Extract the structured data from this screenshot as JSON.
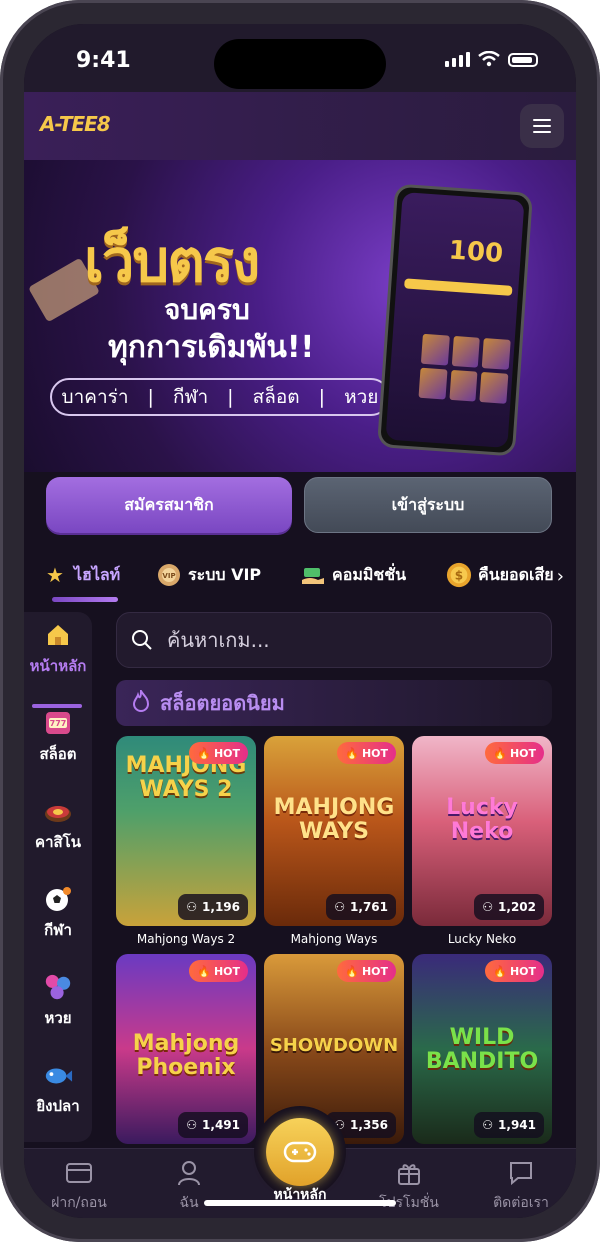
{
  "status_bar": {
    "time": "9:41"
  },
  "header": {
    "logo": "A-TEE8"
  },
  "banner": {
    "headline": "เว็บตรง",
    "line1": "จบครบ",
    "line2": "ทุกการเดิมพัน!!",
    "categories": [
      "บาคาร่า",
      "กีฬา",
      "สล็อต",
      "หวย"
    ],
    "phone_amount": "100"
  },
  "auth": {
    "register": "สมัครสมาชิก",
    "login": "เข้าสู่ระบบ"
  },
  "tabs": [
    {
      "label": "ไฮไลท์",
      "icon": "star-icon"
    },
    {
      "label": "ระบบ VIP",
      "icon": "vip-badge-icon"
    },
    {
      "label": "คอมมิชชั่น",
      "icon": "money-hand-icon"
    },
    {
      "label": "คืนยอดเสีย",
      "icon": "coin-icon"
    }
  ],
  "sidenav": [
    {
      "label": "หน้าหลัก",
      "icon": "home-icon"
    },
    {
      "label": "สล็อต",
      "icon": "slot-machine-icon"
    },
    {
      "label": "คาสิโน",
      "icon": "roulette-icon"
    },
    {
      "label": "กีฬา",
      "icon": "soccer-ball-icon"
    },
    {
      "label": "หวย",
      "icon": "lottery-balls-icon"
    },
    {
      "label": "ยิงปลา",
      "icon": "fish-icon"
    }
  ],
  "search": {
    "placeholder": "ค้นหาเกม..."
  },
  "section": {
    "title": "สล็อตยอดนิยม"
  },
  "hot_label": "HOT",
  "games": [
    {
      "name": "Mahjong Ways 2",
      "art": "MAHJONG WAYS 2",
      "players": "1,196"
    },
    {
      "name": "Mahjong Ways",
      "art": "MAHJONG WAYS",
      "players": "1,761"
    },
    {
      "name": "Lucky Neko",
      "art": "Lucky Neko",
      "players": "1,202"
    },
    {
      "name": "",
      "art": "Mahjong Phoenix",
      "players": "1,491"
    },
    {
      "name": "",
      "art": "SHOWDOWN",
      "players": "1,356"
    },
    {
      "name": "",
      "art": "WILD BANDITO",
      "players": "1,941"
    }
  ],
  "bottom_nav": [
    {
      "label": "ฝาก/ถอน",
      "icon": "card-icon"
    },
    {
      "label": "ฉัน",
      "icon": "user-icon"
    },
    {
      "label": "หน้าหลัก",
      "icon": "gamepad-icon"
    },
    {
      "label": "โปรโมชั่น",
      "icon": "gift-icon"
    },
    {
      "label": "ติดต่อเรา",
      "icon": "chat-icon"
    }
  ]
}
